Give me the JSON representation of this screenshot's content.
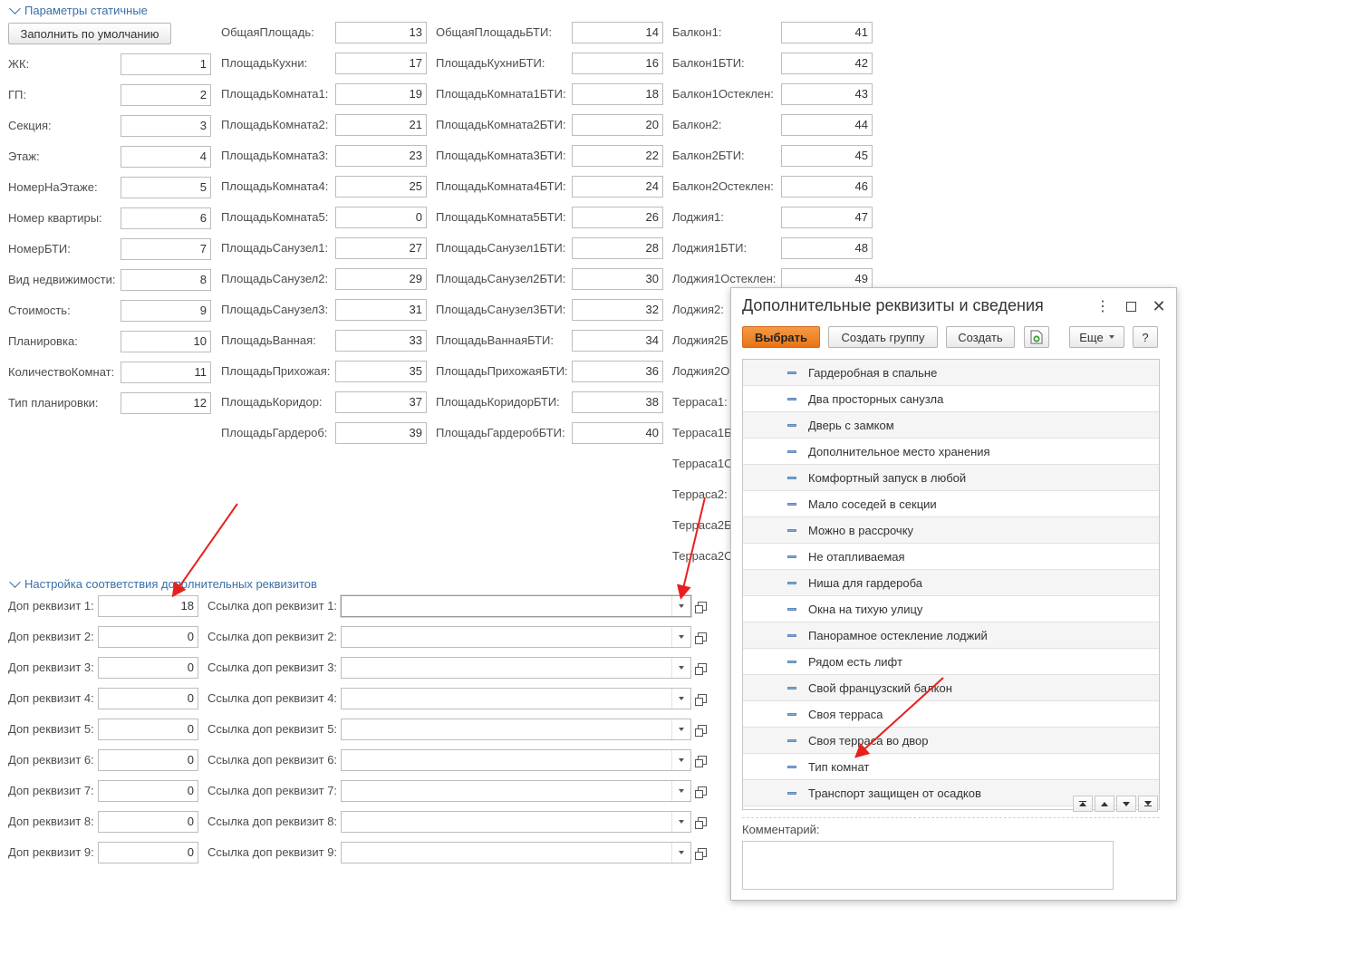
{
  "static_section": {
    "title": "Параметры статичные",
    "fill_default_label": "Заполнить по умолчанию",
    "col1": [
      {
        "label": "ЖК:",
        "value": "1"
      },
      {
        "label": "ГП:",
        "value": "2"
      },
      {
        "label": "Секция:",
        "value": "3"
      },
      {
        "label": "Этаж:",
        "value": "4"
      },
      {
        "label": "НомерНаЭтаже:",
        "value": "5"
      },
      {
        "label": "Номер квартиры:",
        "value": "6"
      },
      {
        "label": "НомерБТИ:",
        "value": "7"
      },
      {
        "label": "Вид недвижимости:",
        "value": "8"
      },
      {
        "label": "Стоимость:",
        "value": "9"
      },
      {
        "label": "Планировка:",
        "value": "10"
      },
      {
        "label": "КоличествоКомнат:",
        "value": "11"
      },
      {
        "label": "Тип планировки:",
        "value": "12"
      }
    ],
    "col2": [
      {
        "label": "ОбщаяПлощадь:",
        "value": "13"
      },
      {
        "label": "ПлощадьКухни:",
        "value": "17"
      },
      {
        "label": "ПлощадьКомната1:",
        "value": "19"
      },
      {
        "label": "ПлощадьКомната2:",
        "value": "21"
      },
      {
        "label": "ПлощадьКомната3:",
        "value": "23"
      },
      {
        "label": "ПлощадьКомната4:",
        "value": "25"
      },
      {
        "label": "ПлощадьКомната5:",
        "value": "0"
      },
      {
        "label": "ПлощадьСанузел1:",
        "value": "27"
      },
      {
        "label": "ПлощадьСанузел2:",
        "value": "29"
      },
      {
        "label": "ПлощадьСанузел3:",
        "value": "31"
      },
      {
        "label": "ПлощадьВанная:",
        "value": "33"
      },
      {
        "label": "ПлощадьПрихожая:",
        "value": "35"
      },
      {
        "label": "ПлощадьКоридор:",
        "value": "37"
      },
      {
        "label": "ПлощадьГардероб:",
        "value": "39"
      }
    ],
    "col3": [
      {
        "label": "ОбщаяПлощадьБТИ:",
        "value": "14"
      },
      {
        "label": "ПлощадьКухниБТИ:",
        "value": "16"
      },
      {
        "label": "ПлощадьКомната1БТИ:",
        "value": "18"
      },
      {
        "label": "ПлощадьКомната2БТИ:",
        "value": "20"
      },
      {
        "label": "ПлощадьКомната3БТИ:",
        "value": "22"
      },
      {
        "label": "ПлощадьКомната4БТИ:",
        "value": "24"
      },
      {
        "label": "ПлощадьКомната5БТИ:",
        "value": "26"
      },
      {
        "label": "ПлощадьСанузел1БТИ:",
        "value": "28"
      },
      {
        "label": "ПлощадьСанузел2БТИ:",
        "value": "30"
      },
      {
        "label": "ПлощадьСанузел3БТИ:",
        "value": "32"
      },
      {
        "label": "ПлощадьВаннаяБТИ:",
        "value": "34"
      },
      {
        "label": "ПлощадьПрихожаяБТИ:",
        "value": "36"
      },
      {
        "label": "ПлощадьКоридорБТИ:",
        "value": "38"
      },
      {
        "label": "ПлощадьГардеробБТИ:",
        "value": "40"
      }
    ],
    "col4": [
      {
        "label": "Балкон1:",
        "value": "41"
      },
      {
        "label": "Балкон1БТИ:",
        "value": "42"
      },
      {
        "label": "Балкон1Остеклен:",
        "value": "43"
      },
      {
        "label": "Балкон2:",
        "value": "44"
      },
      {
        "label": "Балкон2БТИ:",
        "value": "45"
      },
      {
        "label": "Балкон2Остеклен:",
        "value": "46"
      },
      {
        "label": "Лоджия1:",
        "value": "47"
      },
      {
        "label": "Лоджия1БТИ:",
        "value": "48"
      },
      {
        "label": "Лоджия1Остеклен:",
        "value": "49"
      },
      {
        "label": "Лоджия2:",
        "value": ""
      },
      {
        "label": "Лоджия2Б",
        "value": ""
      },
      {
        "label": "Лоджия2О",
        "value": ""
      },
      {
        "label": "Терраса1:",
        "value": ""
      },
      {
        "label": "Терраса1Б",
        "value": ""
      },
      {
        "label": "Терраса1О",
        "value": ""
      },
      {
        "label": "Терраса2:",
        "value": ""
      },
      {
        "label": "Терраса2Б",
        "value": ""
      },
      {
        "label": "Терраса2О",
        "value": ""
      }
    ]
  },
  "mapping_section": {
    "title": "Настройка соответствия дополнительных реквизитов",
    "rows": [
      {
        "label": "Доп реквизит 1:",
        "value": "18",
        "ref_label": "Ссылка доп реквизит 1:",
        "ref_value": ""
      },
      {
        "label": "Доп реквизит 2:",
        "value": "0",
        "ref_label": "Ссылка доп реквизит 2:",
        "ref_value": ""
      },
      {
        "label": "Доп реквизит 3:",
        "value": "0",
        "ref_label": "Ссылка доп реквизит 3:",
        "ref_value": ""
      },
      {
        "label": "Доп реквизит 4:",
        "value": "0",
        "ref_label": "Ссылка доп реквизит 4:",
        "ref_value": ""
      },
      {
        "label": "Доп реквизит 5:",
        "value": "0",
        "ref_label": "Ссылка доп реквизит 5:",
        "ref_value": ""
      },
      {
        "label": "Доп реквизит 6:",
        "value": "0",
        "ref_label": "Ссылка доп реквизит 6:",
        "ref_value": ""
      },
      {
        "label": "Доп реквизит 7:",
        "value": "0",
        "ref_label": "Ссылка доп реквизит 7:",
        "ref_value": ""
      },
      {
        "label": "Доп реквизит 8:",
        "value": "0",
        "ref_label": "Ссылка доп реквизит 8:",
        "ref_value": ""
      },
      {
        "label": "Доп реквизит 9:",
        "value": "0",
        "ref_label": "Ссылка доп реквизит 9:",
        "ref_value": ""
      }
    ]
  },
  "dialog": {
    "title": "Дополнительные реквизиты и сведения",
    "select_label": "Выбрать",
    "create_group_label": "Создать группу",
    "create_label": "Создать",
    "more_label": "Еще",
    "help_label": "?",
    "items": [
      "Гардеробная в спальне",
      "Два просторных санузла",
      "Дверь с замком",
      "Дополнительное место хранения",
      "Комфортный запуск в любой",
      "Мало соседей в секции",
      "Можно в рассрочку",
      "Не отапливаемая",
      "Ниша для гардероба",
      "Окна на тихую улицу",
      "Панорамное остекление лоджий",
      "Рядом есть лифт",
      "Свой французский балкон",
      "Своя терраса",
      "Своя терраса во двор",
      "Тип комнат",
      "Транспорт защищен от осадков"
    ],
    "comment_label": "Комментарий:",
    "comment_value": ""
  },
  "colors": {
    "accent": "#3a6fa8",
    "primary_button": "#f07e22",
    "annotation_arrow": "#e8201d"
  }
}
